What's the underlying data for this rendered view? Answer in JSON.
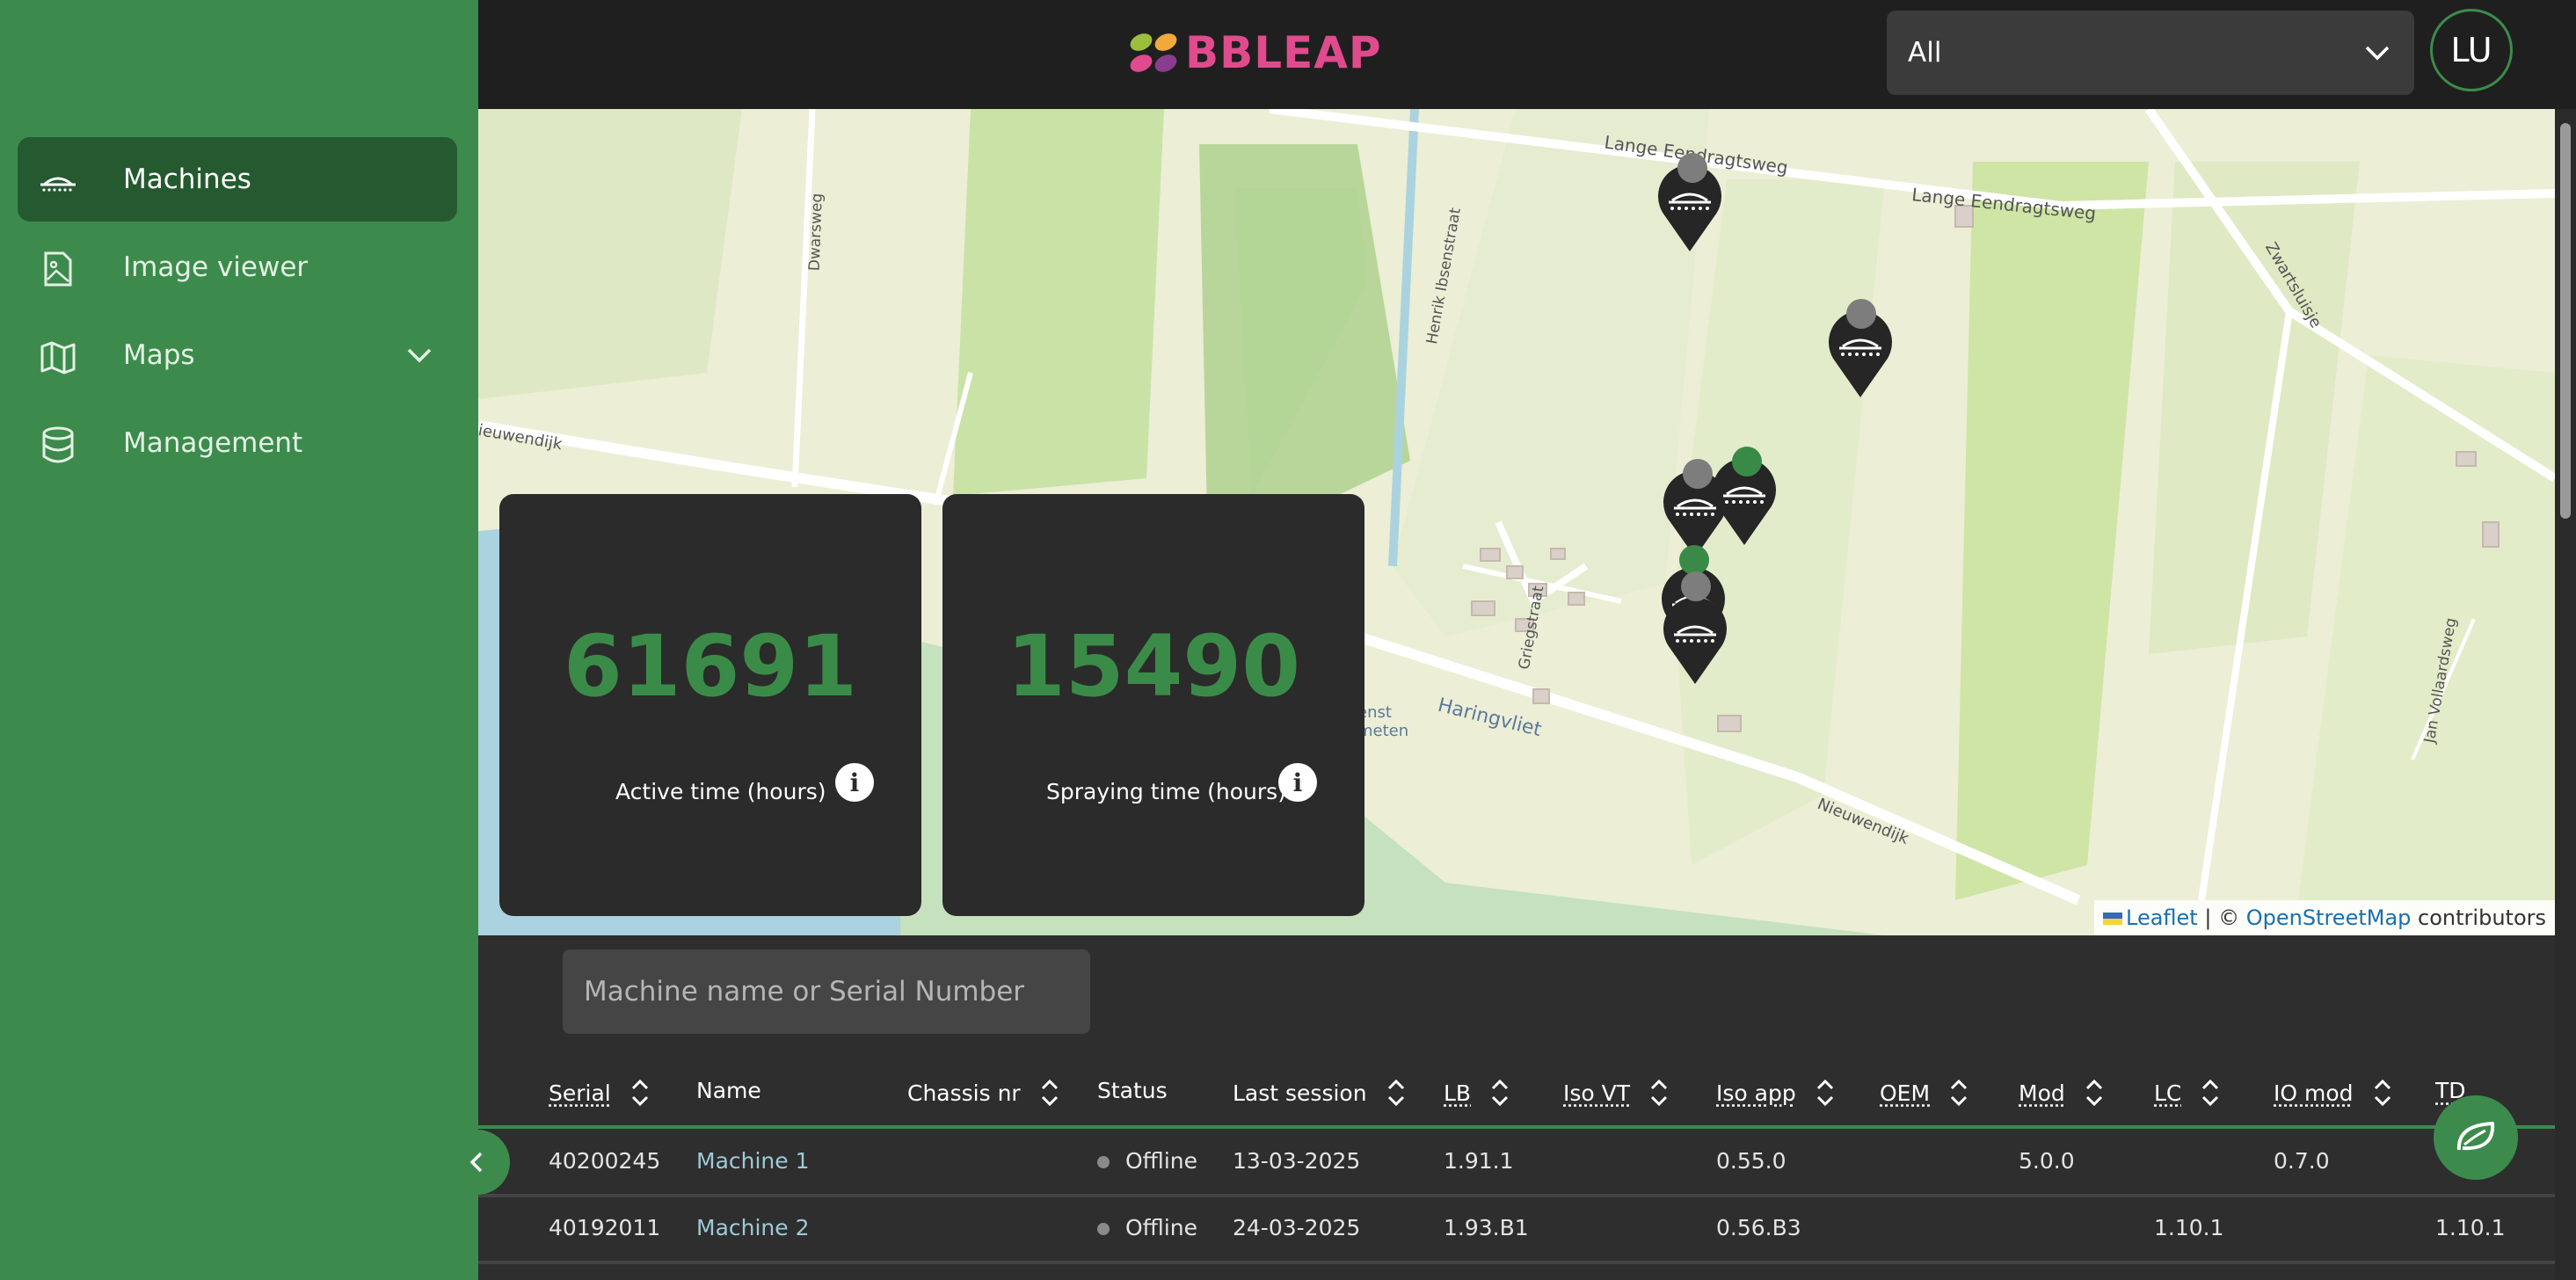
{
  "sidebar": {
    "items": [
      {
        "label": "Machines",
        "icon": "sprayer-icon",
        "active": true
      },
      {
        "label": "Image viewer",
        "icon": "image-file-icon"
      },
      {
        "label": "Maps",
        "icon": "map-icon",
        "has_submenu": true
      },
      {
        "label": "Management",
        "icon": "database-icon"
      }
    ]
  },
  "header": {
    "logo_text": "BBLEAP",
    "filter_value": "All",
    "avatar_initials": "LU"
  },
  "map": {
    "place_labels": [
      "Lange Eendragtsweg",
      "Lange Eendragtsweg",
      "Dwarsweg",
      "Henrik Ibsenstraat",
      "Zwartsluisje",
      "Nieuwendijk",
      "Griegstraat",
      "Haringvliet",
      "Nieuwendijk",
      "Jan Vollaardsweg",
      "enst meten"
    ],
    "markers": [
      {
        "status": "offline"
      },
      {
        "status": "offline"
      },
      {
        "status": "offline"
      },
      {
        "status": "online"
      },
      {
        "status": "online"
      },
      {
        "status": "offline"
      }
    ],
    "attribution": {
      "leaflet": "Leaflet",
      "sep": "| ©",
      "osm": "OpenStreetMap",
      "suffix": "contributors"
    }
  },
  "stats": [
    {
      "value": "61691",
      "label": "Active time (hours)"
    },
    {
      "value": "15490",
      "label": "Spraying time (hours)"
    }
  ],
  "colors": {
    "accent": "#3d8b4c",
    "sidebar_active": "#255a30",
    "stat_number": "#3b8b48",
    "logo": "#e04b8d"
  },
  "search": {
    "placeholder": "Machine name or Serial Number"
  },
  "table": {
    "headers": [
      "Serial",
      "Name",
      "Chassis nr",
      "Status",
      "Last session",
      "LB",
      "Iso VT",
      "Iso app",
      "OEM",
      "Mod",
      "LC",
      "IO mod",
      "TD"
    ],
    "rows": [
      {
        "serial": "40200245",
        "name": "Machine 1",
        "chassis": "",
        "status": "Offline",
        "last_session": "13-03-2025",
        "lb": "1.91.1",
        "iso_vt": "",
        "iso_app": "0.55.0",
        "oem": "",
        "mod": "5.0.0",
        "lc": "",
        "io_mod": "0.7.0",
        "td": ""
      },
      {
        "serial": "40192011",
        "name": "Machine 2",
        "chassis": "",
        "status": "Offline",
        "last_session": "24-03-2025",
        "lb": "1.93.B1",
        "iso_vt": "",
        "iso_app": "0.56.B3",
        "oem": "",
        "mod": "",
        "lc": "1.10.1",
        "io_mod": "",
        "td": "1.10.1"
      }
    ]
  }
}
